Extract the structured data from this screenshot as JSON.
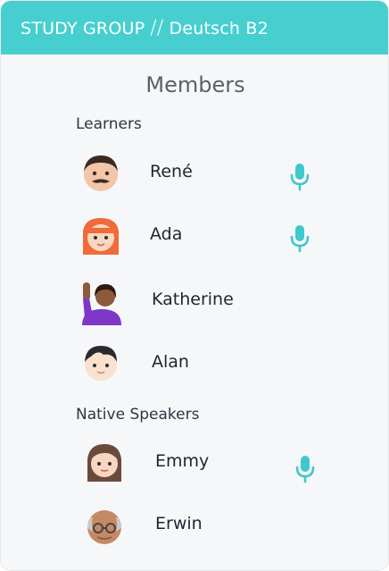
{
  "header": {
    "title_left": "STUDY GROUP",
    "separator": "//",
    "title_right": "Deutsch B2"
  },
  "title": "Members",
  "groups": [
    {
      "label": "Learners",
      "members": [
        {
          "name": "René",
          "avatar": "man-mustache-avatar",
          "speaking": true
        },
        {
          "name": "Ada",
          "avatar": "girl-red-hair-avatar",
          "speaking": true
        },
        {
          "name": "Katherine",
          "avatar": "woman-raising-hand-avatar",
          "speaking": false
        },
        {
          "name": "Alan",
          "avatar": "boy-avatar",
          "speaking": false
        }
      ]
    },
    {
      "label": "Native Speakers",
      "members": [
        {
          "name": "Emmy",
          "avatar": "woman-long-hair-avatar",
          "speaking": true
        },
        {
          "name": "Erwin",
          "avatar": "old-man-glasses-avatar",
          "speaking": false
        }
      ]
    }
  ],
  "colors": {
    "accent": "#47cfd0",
    "mic": "#3fc9cb"
  }
}
